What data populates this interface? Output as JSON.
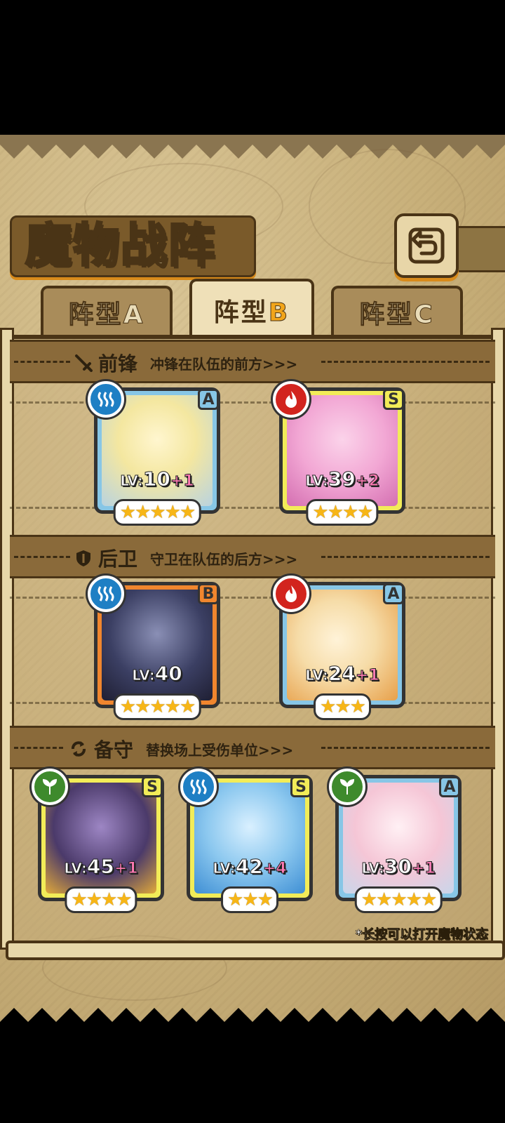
{
  "title": "魔物战阵",
  "back_icon": "return-arrow-icon",
  "tabs": [
    {
      "prefix": "阵型",
      "letter": "A",
      "active": false
    },
    {
      "prefix": "阵型",
      "letter": "B",
      "active": true
    },
    {
      "prefix": "阵型",
      "letter": "C",
      "active": false
    }
  ],
  "sections": {
    "front": {
      "title": "前锋",
      "subtitle": "冲锋在队伍的前方>>>",
      "icon": "sword-icon"
    },
    "back": {
      "title": "后卫",
      "subtitle": "守卫在队伍的后方>>>",
      "icon": "shield-icon"
    },
    "reserve": {
      "title": "备守",
      "subtitle": "替换场上受伤单位>>>",
      "icon": "swap-icon"
    }
  },
  "monsters": [
    {
      "id": "m1",
      "element": "water",
      "rank": "A",
      "lv": "10",
      "plus": "+1",
      "stars": 5,
      "stars_text": "★★★★★",
      "art": "#f4e7a0"
    },
    {
      "id": "m2",
      "element": "fire",
      "rank": "S",
      "lv": "39",
      "plus": "+2",
      "stars": 4,
      "stars_text": "★★★★",
      "art": "#f2a7d4"
    },
    {
      "id": "m3",
      "element": "water",
      "rank": "B",
      "lv": "40",
      "plus": "",
      "stars": 5,
      "stars_text": "★★★★★",
      "art": "#3b3f63"
    },
    {
      "id": "m4",
      "element": "fire",
      "rank": "A",
      "lv": "24",
      "plus": "+1",
      "stars": 3,
      "stars_text": "★★★",
      "art": "#f6dca8"
    },
    {
      "id": "m5",
      "element": "grass",
      "rank": "S",
      "lv": "45",
      "plus": "+1",
      "stars": 4,
      "stars_text": "★★★★",
      "art": "#4b3a6a"
    },
    {
      "id": "m6",
      "element": "water",
      "rank": "S",
      "lv": "42",
      "plus": "+4",
      "stars": 3,
      "stars_text": "★★★",
      "art": "#8cc8ef"
    },
    {
      "id": "m7",
      "element": "grass",
      "rank": "A",
      "lv": "30",
      "plus": "+1",
      "stars": 5,
      "stars_text": "★★★★★",
      "art": "#f5c6d6"
    }
  ],
  "lv_prefix": "LV:",
  "hint": "*长按可以打开魔物状态"
}
